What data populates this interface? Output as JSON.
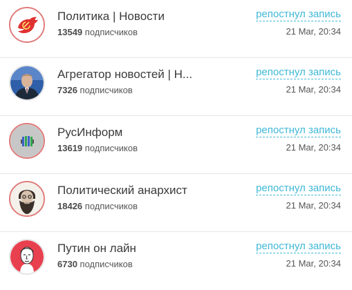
{
  "colors": {
    "accent": "#3fb8d6",
    "avatar_ring": "#e07b7b",
    "divider": "#e6e6e6"
  },
  "items": [
    {
      "name": "Политика | Новости",
      "subscribers": "13549",
      "subscribers_label": "подписчиков",
      "action": "репостнул запись",
      "date": "21 Mar, 20:34",
      "avatar_icon": "red-bird-hammer-sickle-icon"
    },
    {
      "name": "Агрегатор новостей | Н...",
      "subscribers": "7326",
      "subscribers_label": "подписчиков",
      "action": "репостнул запись",
      "date": "21 Mar, 20:34",
      "avatar_icon": "person-photo-icon"
    },
    {
      "name": "РусИнформ",
      "subscribers": "13619",
      "subscribers_label": "подписчиков",
      "action": "репостнул запись",
      "date": "21 Mar, 20:34",
      "avatar_icon": "striped-logo-icon"
    },
    {
      "name": "Политический анархист",
      "subscribers": "18426",
      "subscribers_label": "подписчиков",
      "action": "репостнул запись",
      "date": "21 Mar, 20:34",
      "avatar_icon": "bearded-man-sketch-icon"
    },
    {
      "name": "Путин он лайн",
      "subscribers": "6730",
      "subscribers_label": "подписчиков",
      "action": "репостнул запись",
      "date": "21 Mar, 20:34",
      "avatar_icon": "man-portrait-sketch-icon"
    }
  ]
}
